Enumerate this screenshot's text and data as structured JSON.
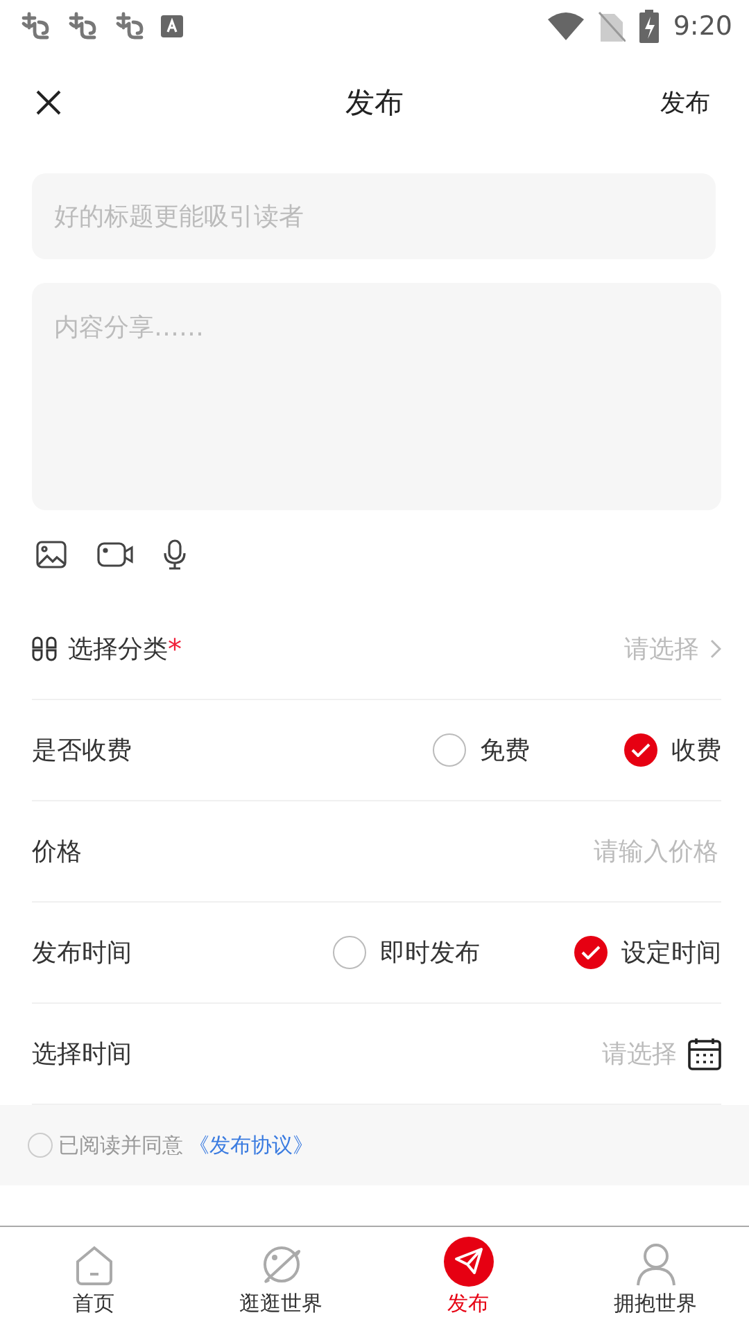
{
  "status_bar": {
    "time": "9:20"
  },
  "header": {
    "title": "发布",
    "action": "发布"
  },
  "title_field": {
    "placeholder": "好的标题更能吸引读者"
  },
  "content_field": {
    "placeholder": "内容分享……"
  },
  "form_rows": [
    {
      "kind": "select",
      "label": "选择分类",
      "required_mark": "*",
      "value": "请选择"
    },
    {
      "kind": "radio",
      "label": "是否收费",
      "options": [
        {
          "label": "免费",
          "selected": false
        },
        {
          "label": "收费",
          "selected": true
        }
      ]
    },
    {
      "kind": "input",
      "label": "价格",
      "placeholder": "请输入价格"
    },
    {
      "kind": "radio",
      "label": "发布时间",
      "options": [
        {
          "label": "即时发布",
          "selected": false
        },
        {
          "label": "设定时间",
          "selected": true
        }
      ]
    },
    {
      "kind": "date",
      "label": "选择时间",
      "value": "请选择"
    }
  ],
  "agreement": {
    "checked": false,
    "text": "已阅读并同意",
    "link": "《发布协议》"
  },
  "bottom_nav": [
    {
      "label": "首页",
      "kind": "home",
      "selected": false
    },
    {
      "label": "逛逛世界",
      "kind": "planet",
      "selected": false
    },
    {
      "label": "发布",
      "kind": "send",
      "selected": true
    },
    {
      "label": "拥抱世界",
      "kind": "person",
      "selected": false
    }
  ]
}
